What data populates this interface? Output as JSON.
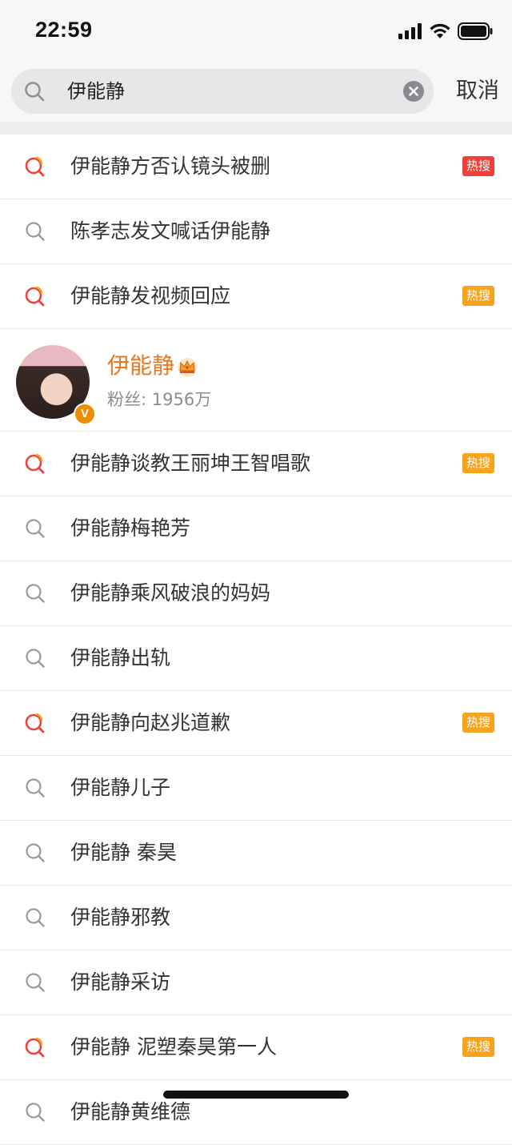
{
  "status_bar": {
    "time": "22:59"
  },
  "search": {
    "query": "伊能静",
    "cancel_label": "取消"
  },
  "user_card": {
    "name": "伊能静",
    "followers": "粉丝: 1956万",
    "verified_badge": "V"
  },
  "suggestions_top": [
    {
      "text": "伊能静方否认镜头被删",
      "hot": true,
      "badge": "热搜",
      "badge_color": "#f0403a"
    },
    {
      "text": "陈孝志发文喊话伊能静",
      "hot": false
    },
    {
      "text": "伊能静发视频回应",
      "hot": true,
      "badge": "热搜",
      "badge_color": "#f9a21b"
    }
  ],
  "suggestions": [
    {
      "text": "伊能静谈教王丽坤王智唱歌",
      "hot": true,
      "badge": "热搜",
      "badge_color": "#f9a21b"
    },
    {
      "text": "伊能静梅艳芳",
      "hot": false
    },
    {
      "text": "伊能静乘风破浪的妈妈",
      "hot": false
    },
    {
      "text": "伊能静出轨",
      "hot": false
    },
    {
      "text": "伊能静向赵兆道歉",
      "hot": true,
      "badge": "热搜",
      "badge_color": "#f9a21b"
    },
    {
      "text": "伊能静儿子",
      "hot": false
    },
    {
      "text": "伊能静 秦昊",
      "hot": false
    },
    {
      "text": "伊能静邪教",
      "hot": false
    },
    {
      "text": "伊能静采访",
      "hot": false
    },
    {
      "text": "伊能静 泥塑秦昊第一人",
      "hot": true,
      "badge": "热搜",
      "badge_color": "#f9a21b"
    },
    {
      "text": "伊能静黄维德",
      "hot": false
    }
  ],
  "colors": {
    "accent_orange": "#e8771e",
    "hot_red": "#f0403a",
    "hot_orange": "#f9a21b"
  }
}
